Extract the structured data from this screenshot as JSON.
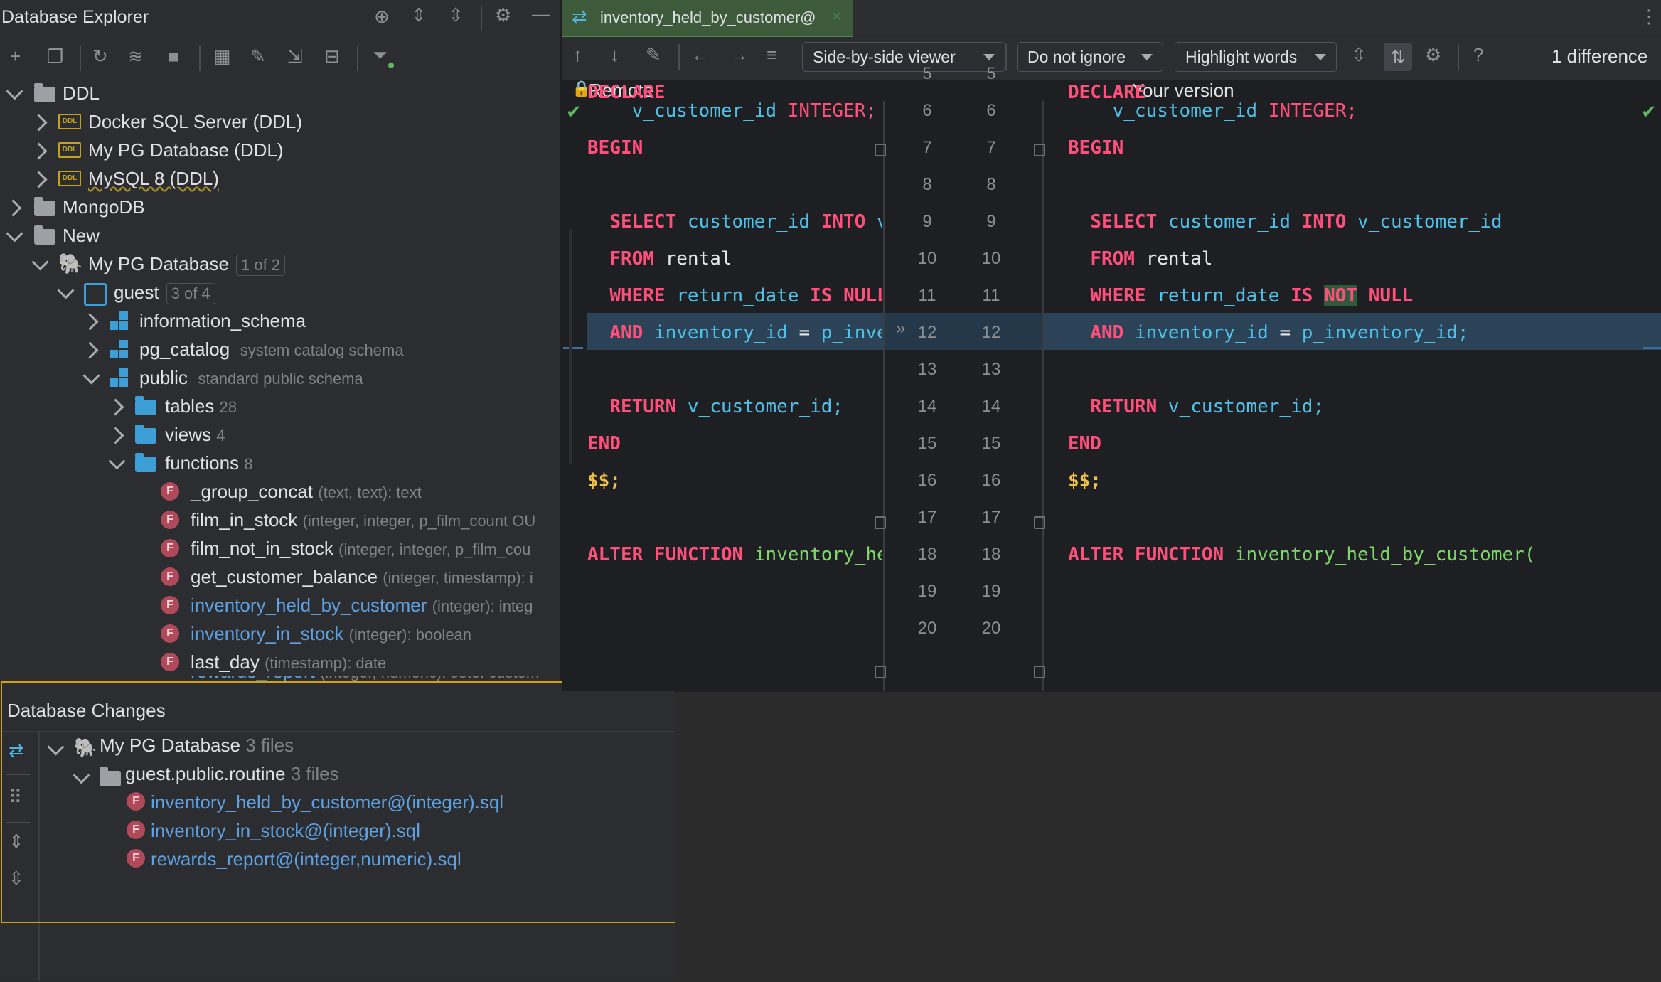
{
  "explorer": {
    "title": "Database Explorer",
    "tree": {
      "ddl": "DDL",
      "docker": "Docker SQL Server (DDL)",
      "mypg_ddl": "My PG Database (DDL)",
      "mysql": "MySQL 8 (DDL)",
      "mongodb": "MongoDB",
      "new": "New",
      "mypg": "My PG Database",
      "mypg_badge": "1 of 2",
      "guest": "guest",
      "guest_badge": "3 of 4",
      "info_schema": "information_schema",
      "pg_catalog": "pg_catalog",
      "pg_catalog_hint": "system catalog schema",
      "public": "public",
      "public_hint": "standard public schema",
      "tables": "tables",
      "tables_count": "28",
      "views": "views",
      "views_count": "4",
      "functions": "functions",
      "functions_count": "8",
      "fn": [
        {
          "name": "_group_concat",
          "sig": "(text, text): text"
        },
        {
          "name": "film_in_stock",
          "sig": "(integer, integer, p_film_count OU"
        },
        {
          "name": "film_not_in_stock",
          "sig": "(integer, integer, p_film_cou"
        },
        {
          "name": "get_customer_balance",
          "sig": "(integer, timestamp): i"
        },
        {
          "name": "inventory_held_by_customer",
          "sig": "(integer): integ"
        },
        {
          "name": "inventory_in_stock",
          "sig": "(integer): boolean"
        },
        {
          "name": "last_day",
          "sig": "(timestamp): date"
        },
        {
          "name": "rewards_report",
          "sig": "(integer, numeric): setof custom"
        }
      ]
    }
  },
  "changes": {
    "title": "Database Changes",
    "db": "My PG Database",
    "db_count": "3 files",
    "routine": "guest.public.routine",
    "routine_count": "3 files",
    "files": [
      "inventory_held_by_customer@(integer).sql",
      "inventory_in_stock@(integer).sql",
      "rewards_report@(integer,numeric).sql"
    ]
  },
  "editor": {
    "tab": "inventory_held_by_customer@",
    "viewer": "Side-by-side viewer",
    "ignore": "Do not ignore",
    "highlight": "Highlight words",
    "diff_count": "1 difference",
    "left_title": "Remote",
    "right_title": "Your version",
    "line_numbers": [
      "5",
      "6",
      "7",
      "8",
      "9",
      "10",
      "11",
      "12",
      "13",
      "14",
      "15",
      "16",
      "17",
      "18",
      "19",
      "20"
    ],
    "left": {
      "l5": "DECLARE",
      "l6_id": "v_customer_id",
      "l6_kw": "INTEGER;",
      "l7": "BEGIN",
      "l9_kw1": "SELECT",
      "l9_id1": "customer_id",
      "l9_kw2": "INTO",
      "l9_id2": "v_customer_id",
      "l10_kw": "FROM",
      "l10_pl": "rental",
      "l11_kw1": "WHERE",
      "l11_id": "return_date",
      "l11_kw2": "IS",
      "l11_kw3": "NULL",
      "l12_kw": "AND",
      "l12_id1": "inventory_id",
      "l12_eq": "=",
      "l12_id2": "p_inventory_id;",
      "l14_kw": "RETURN",
      "l14_id": "v_customer_id;",
      "l15": "END",
      "l16": "$$;",
      "l18_kw": "ALTER FUNCTION",
      "l18_fn": "inventory_held_by_custome"
    },
    "right": {
      "l5": "DECLARE",
      "l6_id": "v_customer_id",
      "l6_kw": "INTEGER;",
      "l7": "BEGIN",
      "l9_kw1": "SELECT",
      "l9_id1": "customer_id",
      "l9_kw2": "INTO",
      "l9_id2": "v_customer_id",
      "l10_kw": "FROM",
      "l10_pl": "rental",
      "l11_kw1": "WHERE",
      "l11_id": "return_date",
      "l11_kw2": "IS",
      "l11_not": "NOT",
      "l11_kw3": "NULL",
      "l12_kw": "AND",
      "l12_id1": "inventory_id",
      "l12_eq": "=",
      "l12_id2": "p_inventory_id;",
      "l14_kw": "RETURN",
      "l14_id": "v_customer_id;",
      "l15": "END",
      "l16": "$$;",
      "l18_kw": "ALTER FUNCTION",
      "l18_fn": "inventory_held_by_customer("
    }
  },
  "colors": {
    "keyword": "#ff4f7b",
    "identifier": "#4fc1e9",
    "function": "#7ed66b",
    "highlight_frame": "#d1a116"
  }
}
